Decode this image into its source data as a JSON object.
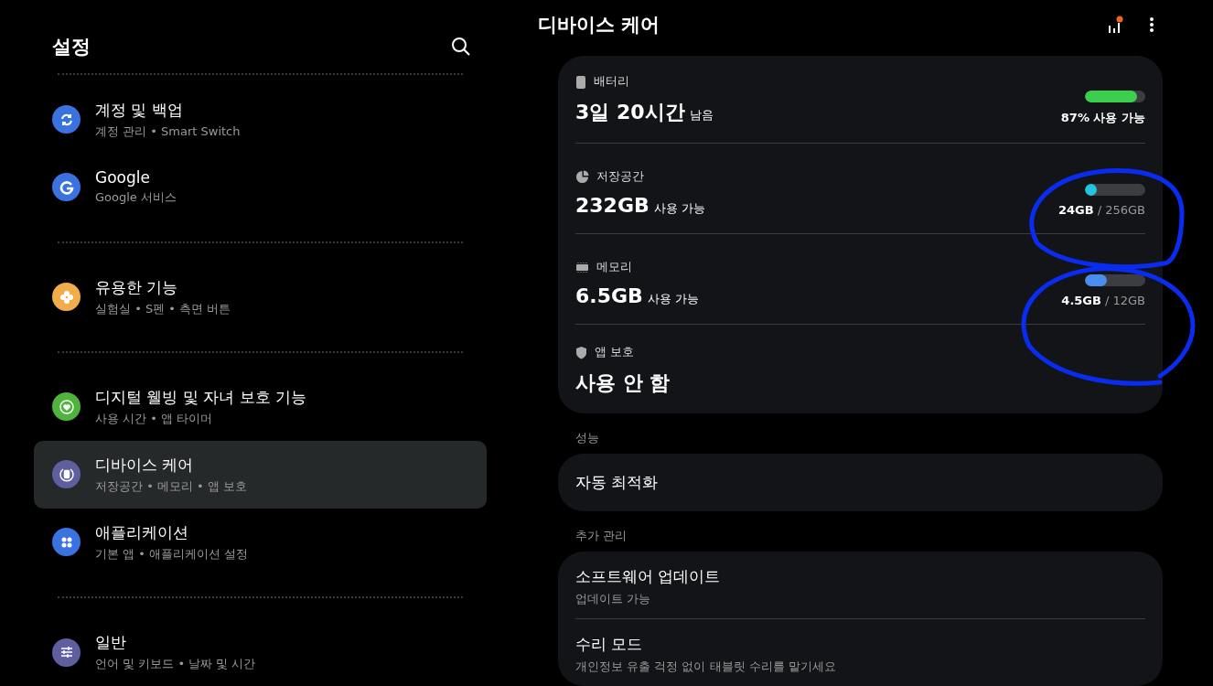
{
  "sidebar": {
    "title": "설정",
    "groups": [
      {
        "items": [
          {
            "title": "계정 및 백업",
            "subtitle": "계정 관리 • Smart Switch",
            "selected": false
          },
          {
            "title": "Google",
            "subtitle": "Google 서비스",
            "selected": false
          }
        ]
      },
      {
        "items": [
          {
            "title": "유용한 기능",
            "subtitle": "실험실 • S펜 • 측면 버튼",
            "selected": false
          }
        ]
      },
      {
        "items": [
          {
            "title": "디지털 웰빙 및 자녀 보호 기능",
            "subtitle": "사용 시간 • 앱 타이머",
            "selected": false
          },
          {
            "title": "디바이스 케어",
            "subtitle": "저장공간 • 메모리 • 앱 보호",
            "selected": true
          },
          {
            "title": "애플리케이션",
            "subtitle": "기본 앱 • 애플리케이션 설정",
            "selected": false
          }
        ]
      },
      {
        "items": [
          {
            "title": "일반",
            "subtitle": "언어 및 키보드 • 날짜 및 시간",
            "selected": false
          }
        ]
      }
    ]
  },
  "header": {
    "title": "디바이스 케어"
  },
  "status_card": [
    {
      "kind": "meter",
      "label": "배터리",
      "value": "3일 20시간",
      "unit": "남음",
      "level": 0.87,
      "color": "#3ccf4e",
      "reading_main": "87% 사용 가능"
    },
    {
      "kind": "meter",
      "label": "저장공간",
      "value": "232GB",
      "unit": "사용 가능",
      "level": 0.09,
      "color": "#22c5e0",
      "reading_main": "24GB",
      "reading_total": "/ 256GB"
    },
    {
      "kind": "meter",
      "label": "메모리",
      "value": "6.5GB",
      "unit": "사용 가능",
      "level": 0.36,
      "color": "#4a8cf0",
      "reading_main": "4.5GB",
      "reading_total": "/ 12GB"
    },
    {
      "kind": "plain",
      "label": "앱 보호",
      "value": "사용 안 함"
    }
  ],
  "sections": [
    {
      "heading": "성능",
      "items": [
        {
          "title": "자동 최적화"
        }
      ]
    },
    {
      "heading": "추가 관리",
      "items": [
        {
          "title": "소프트웨어 업데이트",
          "subtitle": "업데이트 가능"
        },
        {
          "title": "수리 모드",
          "subtitle": "개인정보 유출 걱정 없이 태블릿 수리를 맡기세요"
        }
      ]
    }
  ]
}
